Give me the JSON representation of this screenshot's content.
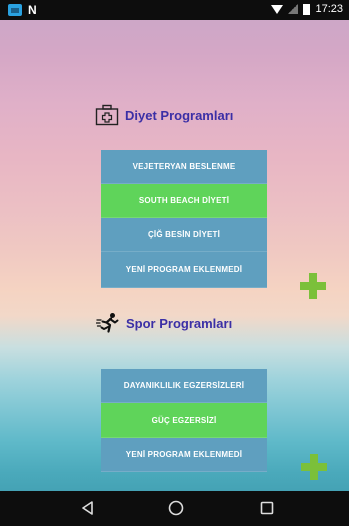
{
  "status_bar": {
    "notification_letter": "N",
    "time": "17:23"
  },
  "diet_section": {
    "title": "Diyet Programları",
    "items": [
      {
        "label": "VEJETERYAN BESLENME",
        "color": "#5f9fbf"
      },
      {
        "label": "SOUTH BEACH DİYETİ",
        "color": "#5fd45a"
      },
      {
        "label": "ÇİĞ BESİN DİYETİ",
        "color": "#5f9fbf"
      },
      {
        "label": "YENİ PROGRAM EKLENMEDİ",
        "color": "#5f9fbf"
      }
    ],
    "add_icon": "plus-icon"
  },
  "sport_section": {
    "title": "Spor Programları",
    "items": [
      {
        "label": "DAYANIKLILIK EGZERSİZLERİ",
        "color": "#5f9fbf"
      },
      {
        "label": "GÜÇ EGZERSİZİ",
        "color": "#5fd45a"
      },
      {
        "label": "YENİ PROGRAM EKLENMEDİ",
        "color": "#5f9fbf"
      }
    ],
    "add_icon": "plus-icon"
  },
  "nav_bar": {
    "back_icon": "back-triangle-icon",
    "home_icon": "home-circle-icon",
    "recents_icon": "recents-square-icon"
  },
  "colors": {
    "accent_text": "#3b2fa6",
    "menu_blue": "#5f9fbf",
    "menu_green": "#5fd45a",
    "plus_green": "#7bc03a"
  }
}
